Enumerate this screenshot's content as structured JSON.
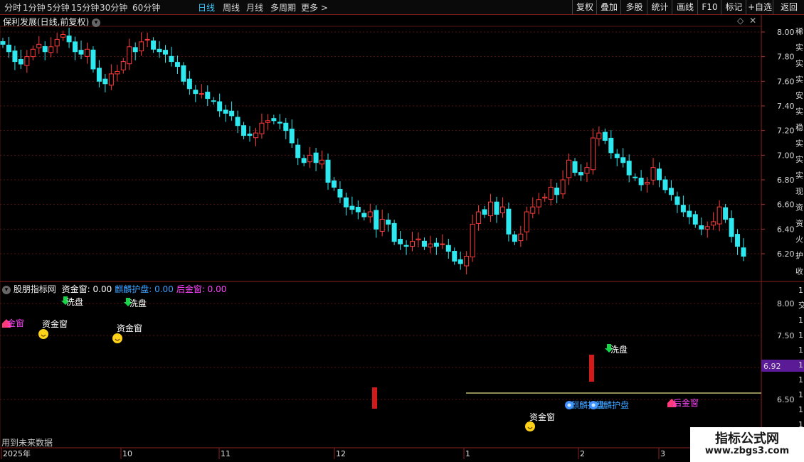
{
  "toolbar": {
    "periods": [
      "分时",
      "1分钟",
      "5分钟",
      "15分钟",
      "30分钟",
      "60分钟",
      "日线",
      "周线",
      "月线",
      "多周期",
      "更多 >"
    ],
    "active_period": "日线",
    "right_buttons": [
      "复权",
      "叠加",
      "多股",
      "统计",
      "画线",
      "F10",
      "标记",
      "+自选",
      "返回"
    ]
  },
  "main_panel": {
    "title": "保利发展(日线,前复权)",
    "price_axis_labels": [
      "8.00",
      "7.80",
      "7.60",
      "7.40",
      "7.20",
      "7.00",
      "6.80",
      "6.60",
      "6.40",
      "6.20"
    ]
  },
  "indicator_panel": {
    "name": "股朋指标网",
    "values": [
      {
        "label": "资金窗: 0.00",
        "color": "#ffffff"
      },
      {
        "label": "麒麟护盘: 0.00",
        "color": "#3aa0ff"
      },
      {
        "label": "后金窗: 0.00",
        "color": "#ff44ff"
      }
    ],
    "axis_labels": [
      "8.00",
      "7.50",
      "7.00",
      "6.50"
    ],
    "highlight_value": "6.92",
    "highlight_color": "#5b1a96",
    "footer_note": "用到未来数据",
    "signals": {
      "xipan": "洗盘",
      "zijinchuang": "资金窗",
      "qilin": "麒麟护盘",
      "houjinchuang": "后金窗"
    }
  },
  "date_axis": [
    "2025年",
    "10",
    "11",
    "12",
    "1",
    "2",
    "3"
  ],
  "right_edge_chars": [
    "稀",
    "实",
    "实",
    "实",
    "安",
    "实",
    "稳",
    "实",
    "实",
    "实",
    "现",
    "资",
    "资",
    "火",
    "护",
    "收"
  ],
  "right_edge_chars2": [
    "1",
    "交",
    "1",
    "1",
    "1",
    "1",
    "1",
    "1",
    "1",
    "1",
    "1"
  ],
  "watermark": {
    "title": "指标公式网",
    "url": "www.zbgs3.com"
  },
  "colors": {
    "up": "#ff3b3b",
    "down": "#2ee8f0",
    "grid": "#5a1414",
    "accent": "#3cc8ff"
  }
}
